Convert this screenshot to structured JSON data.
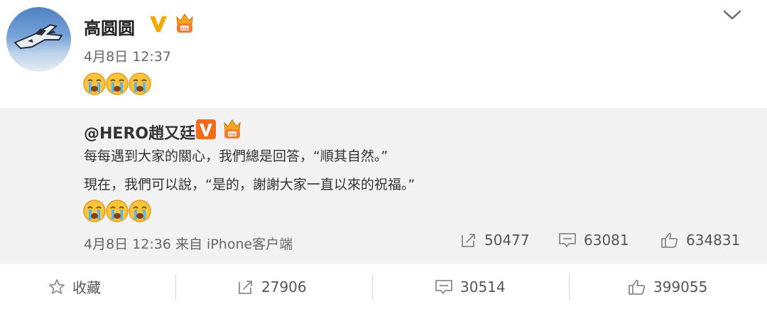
{
  "post": {
    "username": "高圆圆",
    "timestamp": "4月8日 12:37",
    "emoji_name": "crying-face",
    "emoji_count": 3
  },
  "repost": {
    "author": "@HERO趙又廷",
    "line1": "每每遇到大家的關心，我們總是回答，“順其自然。”",
    "line2": "現在，我們可以說，“是的，謝謝大家一直以來的祝福。”",
    "meta": "4月8日 12:36 来自 iPhone客户端",
    "reposts": "50477",
    "comments": "63081",
    "likes": "634831"
  },
  "actions": {
    "favorite_label": "收藏",
    "reposts": "27906",
    "comments": "30514",
    "likes": "399055"
  },
  "colors": {
    "badge_v": "#f2a900",
    "repost_bg": "#f2f2f2",
    "icon_gray": "#8a8a8a"
  },
  "icons": [
    "verified-v-icon",
    "vip-crown-icon",
    "chevron-down-icon",
    "repost-icon",
    "comment-icon",
    "like-icon",
    "star-icon"
  ]
}
